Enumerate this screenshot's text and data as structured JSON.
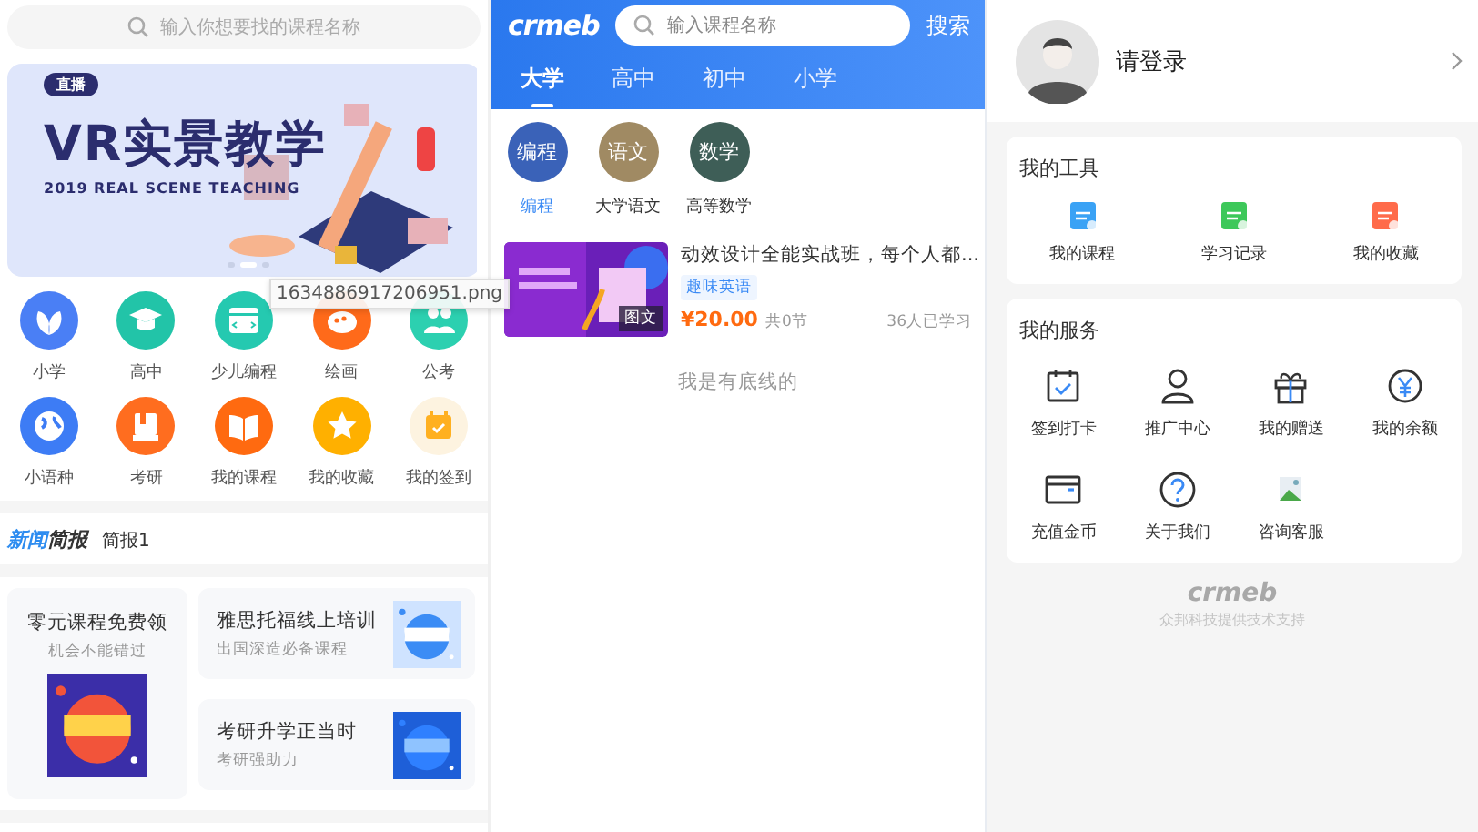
{
  "left": {
    "search": {
      "placeholder": "输入你想要找的课程名称"
    },
    "banner": {
      "badge": "直播",
      "title": "VR实景教学",
      "subtitle": "2019 REAL SCENE TEACHING",
      "dots": [
        {
          "selected": false
        },
        {
          "selected": true
        },
        {
          "selected": false
        }
      ]
    },
    "shortcuts": [
      {
        "label": "小学",
        "color": "#4a7ff5"
      },
      {
        "label": "高中",
        "color": "#22c4a8"
      },
      {
        "label": "少儿编程",
        "color": "#25c9b0"
      },
      {
        "label": "绘画",
        "color": "#ff6a1a"
      },
      {
        "label": "公考",
        "color": "#2cd0b0"
      },
      {
        "label": "小语种",
        "color": "#3d7cf5"
      },
      {
        "label": "考研",
        "color": "#ff6d1f"
      },
      {
        "label": "我的课程",
        "color": "#ff6a10"
      },
      {
        "label": "我的收藏",
        "color": "#ffb000"
      },
      {
        "label": "我的签到",
        "color": "#fdf3e0"
      }
    ],
    "news": {
      "title_a": "新闻",
      "title_b": "简报",
      "text": "简报1"
    },
    "promos": [
      {
        "title": "零元课程免费领",
        "subtitle": "机会不能错过"
      },
      {
        "title": "雅思托福线上培训",
        "subtitle": "出国深造必备课程"
      },
      {
        "title": "考研升学正当时",
        "subtitle": "考研强助力"
      }
    ]
  },
  "mid": {
    "logo": "crmeb",
    "search": {
      "placeholder": "输入课程名称"
    },
    "search_button": "搜索",
    "tabs": [
      {
        "label": "大学",
        "selected": true
      },
      {
        "label": "高中",
        "selected": false
      },
      {
        "label": "初中",
        "selected": false
      },
      {
        "label": "小学",
        "selected": false
      }
    ],
    "categories": [
      {
        "badge": "编程",
        "label": "编程",
        "selected": true,
        "color": "#3a62b8"
      },
      {
        "badge": "语文",
        "label": "大学语文",
        "selected": false,
        "color": "#a08a63"
      },
      {
        "badge": "数学",
        "label": "高等数学",
        "selected": false,
        "color": "#3e5e57"
      }
    ],
    "course": {
      "badge": "图文",
      "title": "动效设计全能实战班，每个人都...",
      "tag": "趣味英语",
      "price": "¥20.00",
      "lessons": "共0节",
      "learners": "36人已学习"
    },
    "end_note": "我是有底线的"
  },
  "right": {
    "login": "请登录",
    "tools": {
      "title": "我的工具",
      "items": [
        "我的课程",
        "学习记录",
        "我的收藏"
      ]
    },
    "services": {
      "title": "我的服务",
      "items": [
        "签到打卡",
        "推广中心",
        "我的赠送",
        "我的余额",
        "充值金币",
        "关于我们",
        "咨询客服"
      ]
    },
    "footer": {
      "logo": "crmeb",
      "text": "众邦科技提供技术支持"
    }
  },
  "tooltip": {
    "text": "1634886917206951.png"
  }
}
